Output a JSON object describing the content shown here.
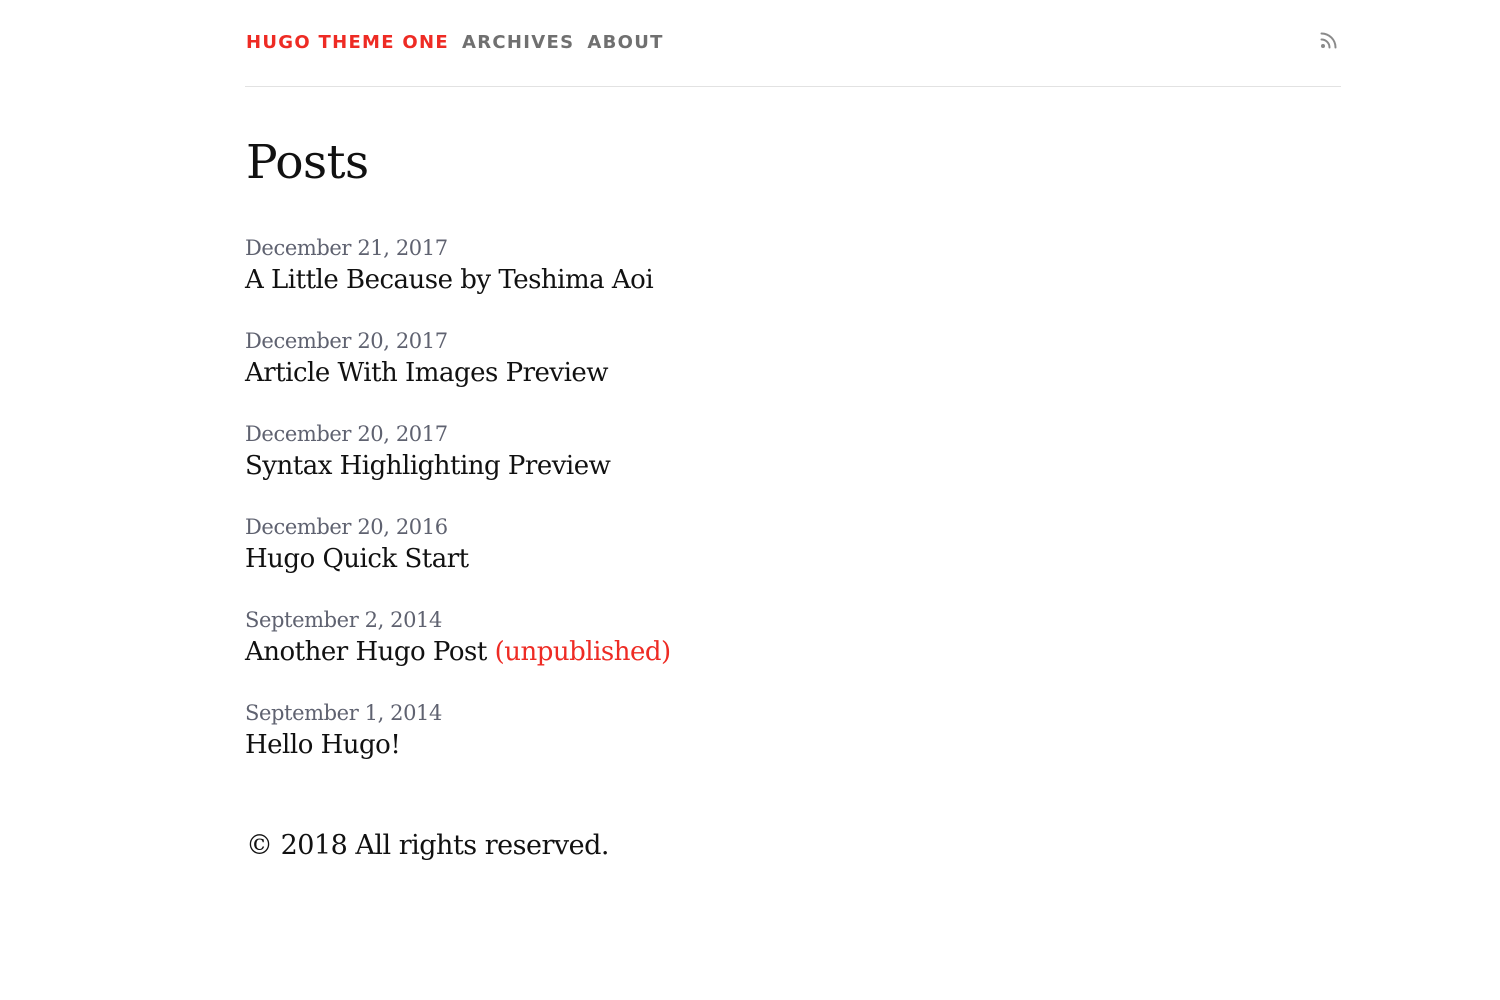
{
  "nav": {
    "brand": "HUGO THEME ONE",
    "links": [
      {
        "label": "ARCHIVES"
      },
      {
        "label": "ABOUT"
      }
    ],
    "rss_icon": "rss-icon"
  },
  "main": {
    "title": "Posts",
    "posts": [
      {
        "date": "December 21, 2017",
        "title": "A Little Because by Teshima Aoi"
      },
      {
        "date": "December 20, 2017",
        "title": "Article With Images Preview"
      },
      {
        "date": "December 20, 2017",
        "title": "Syntax Highlighting Preview"
      },
      {
        "date": "December 20, 2016",
        "title": "Hugo Quick Start"
      },
      {
        "date": "September 2, 2014",
        "title": "Another Hugo Post",
        "status": "(unpublished)"
      },
      {
        "date": "September 1, 2014",
        "title": "Hello Hugo!"
      }
    ]
  },
  "footer": {
    "copyright": "© 2018 All rights reserved."
  },
  "colors": {
    "accent": "#ee2b24",
    "nav_text": "#707070",
    "date_text": "#5f6270",
    "divider": "#e2e2e2"
  }
}
